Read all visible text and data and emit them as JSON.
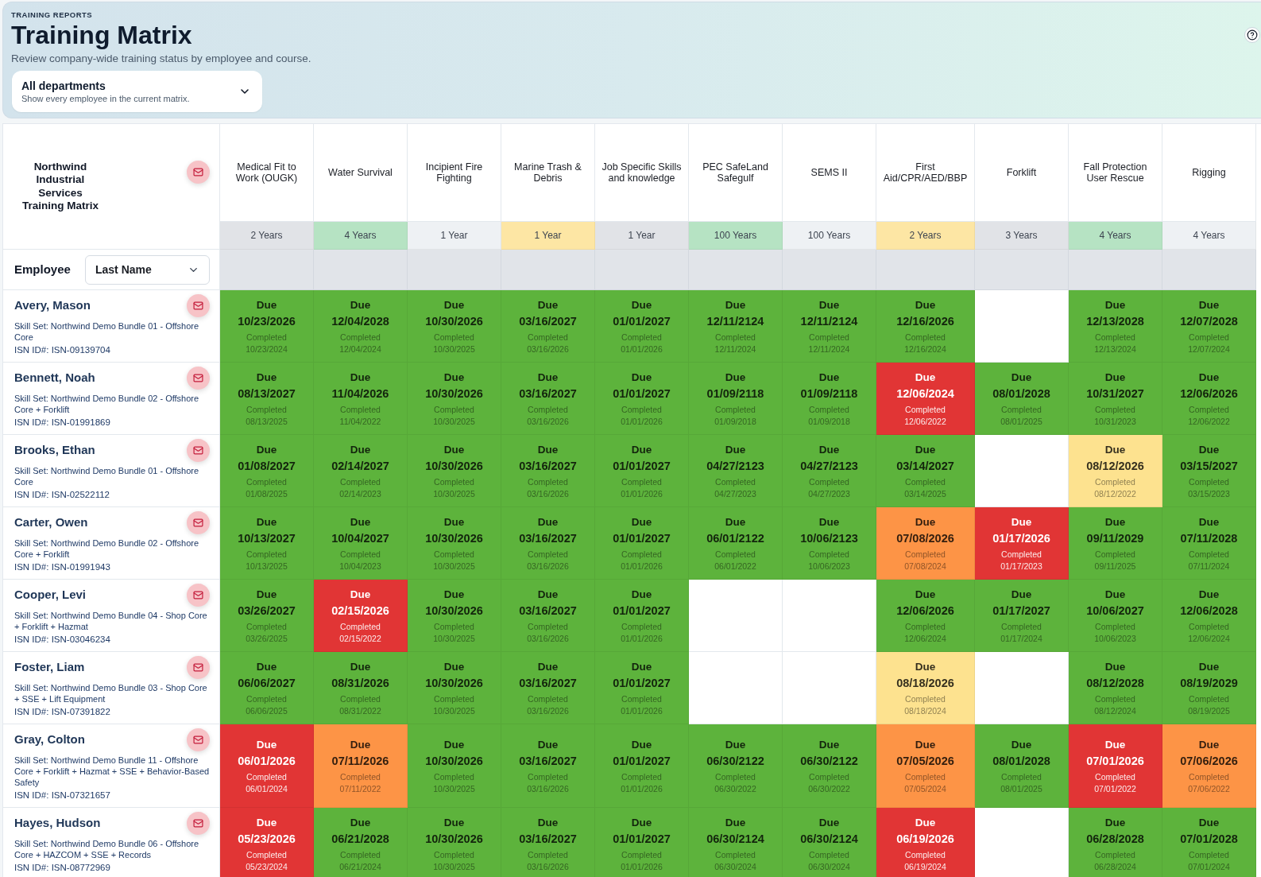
{
  "header": {
    "eyebrow": "TRAINING REPORTS",
    "title": "Training Matrix",
    "description": "Review company-wide training status by employee and course.",
    "department_select": {
      "value": "All departments",
      "hint": "Show every employee in the current matrix."
    }
  },
  "matrix": {
    "title": "Northwind Industrial Services Training Matrix",
    "employee_label": "Employee",
    "sort_select": {
      "value": "Last Name"
    },
    "courses": [
      {
        "name": "Medical Fit to Work (OUGK)",
        "period": "2 Years",
        "color": "#e1e3e7"
      },
      {
        "name": "Water Survival",
        "period": "4 Years",
        "color": "#b6e3c3"
      },
      {
        "name": "Incipient Fire Fighting",
        "period": "1 Year",
        "color": "#eef1f4"
      },
      {
        "name": "Marine Trash & Debris",
        "period": "1 Year",
        "color": "#fde6a4"
      },
      {
        "name": "Job Specific Skills and knowledge",
        "period": "1 Year",
        "color": "#e1e3e7"
      },
      {
        "name": "PEC SafeLand Safegulf",
        "period": "100 Years",
        "color": "#b6e3c3"
      },
      {
        "name": "SEMS II",
        "period": "100 Years",
        "color": "#eef1f4"
      },
      {
        "name": "First Aid/CPR/AED/BBP",
        "period": "2 Years",
        "color": "#fde6a4"
      },
      {
        "name": "Forklift",
        "period": "3 Years",
        "color": "#e1e3e7"
      },
      {
        "name": "Fall Protection User Rescue",
        "period": "4 Years",
        "color": "#b6e3c3"
      },
      {
        "name": "Rigging",
        "period": "4 Years",
        "color": "#eef1f4"
      }
    ],
    "rows": [
      {
        "name": "Avery, Mason",
        "skill_set": "Skill Set: Northwind Demo Bundle 01 - Offshore Core",
        "isn_id": "ISN ID#: ISN-09139704",
        "cells": [
          {
            "kind": "record",
            "color": "#5db33c",
            "due_label": "Due",
            "due": "10/23/2026",
            "completed_label": "Completed",
            "completed": "10/23/2024"
          },
          {
            "kind": "record",
            "color": "#5db33c",
            "due_label": "Due",
            "due": "12/04/2028",
            "completed_label": "Completed",
            "completed": "12/04/2024"
          },
          {
            "kind": "record",
            "color": "#5db33c",
            "due_label": "Due",
            "due": "10/30/2026",
            "completed_label": "Completed",
            "completed": "10/30/2025"
          },
          {
            "kind": "record",
            "color": "#5db33c",
            "due_label": "Due",
            "due": "03/16/2027",
            "completed_label": "Completed",
            "completed": "03/16/2026"
          },
          {
            "kind": "record",
            "color": "#5db33c",
            "due_label": "Due",
            "due": "01/01/2027",
            "completed_label": "Completed",
            "completed": "01/01/2026"
          },
          {
            "kind": "record",
            "color": "#5db33c",
            "due_label": "Due",
            "due": "12/11/2124",
            "completed_label": "Completed",
            "completed": "12/11/2024"
          },
          {
            "kind": "record",
            "color": "#5db33c",
            "due_label": "Due",
            "due": "12/11/2124",
            "completed_label": "Completed",
            "completed": "12/11/2024"
          },
          {
            "kind": "record",
            "color": "#5db33c",
            "due_label": "Due",
            "due": "12/16/2026",
            "completed_label": "Completed",
            "completed": "12/16/2024"
          },
          {
            "kind": "blank"
          },
          {
            "kind": "record",
            "color": "#5db33c",
            "due_label": "Due",
            "due": "12/13/2028",
            "completed_label": "Completed",
            "completed": "12/13/2024"
          },
          {
            "kind": "record",
            "color": "#5db33c",
            "due_label": "Due",
            "due": "12/07/2028",
            "completed_label": "Completed",
            "completed": "12/07/2024"
          }
        ]
      },
      {
        "name": "Bennett, Noah",
        "skill_set": "Skill Set: Northwind Demo Bundle 02 - Offshore Core + Forklift",
        "isn_id": "ISN ID#: ISN-01991869",
        "cells": [
          {
            "kind": "record",
            "color": "#5db33c",
            "due_label": "Due",
            "due": "08/13/2027",
            "completed_label": "Completed",
            "completed": "08/13/2025"
          },
          {
            "kind": "record",
            "color": "#5db33c",
            "due_label": "Due",
            "due": "11/04/2026",
            "completed_label": "Completed",
            "completed": "11/04/2022"
          },
          {
            "kind": "record",
            "color": "#5db33c",
            "due_label": "Due",
            "due": "10/30/2026",
            "completed_label": "Completed",
            "completed": "10/30/2025"
          },
          {
            "kind": "record",
            "color": "#5db33c",
            "due_label": "Due",
            "due": "03/16/2027",
            "completed_label": "Completed",
            "completed": "03/16/2026"
          },
          {
            "kind": "record",
            "color": "#5db33c",
            "due_label": "Due",
            "due": "01/01/2027",
            "completed_label": "Completed",
            "completed": "01/01/2026"
          },
          {
            "kind": "record",
            "color": "#5db33c",
            "due_label": "Due",
            "due": "01/09/2118",
            "completed_label": "Completed",
            "completed": "01/09/2018"
          },
          {
            "kind": "record",
            "color": "#5db33c",
            "due_label": "Due",
            "due": "01/09/2118",
            "completed_label": "Completed",
            "completed": "01/09/2018"
          },
          {
            "kind": "record",
            "color": "#e13535",
            "due_label": "Due",
            "due": "12/06/2024",
            "completed_label": "Completed",
            "completed": "12/06/2022"
          },
          {
            "kind": "record",
            "color": "#5db33c",
            "due_label": "Due",
            "due": "08/01/2028",
            "completed_label": "Completed",
            "completed": "08/01/2025"
          },
          {
            "kind": "record",
            "color": "#5db33c",
            "due_label": "Due",
            "due": "10/31/2027",
            "completed_label": "Completed",
            "completed": "10/31/2023"
          },
          {
            "kind": "record",
            "color": "#5db33c",
            "due_label": "Due",
            "due": "12/06/2026",
            "completed_label": "Completed",
            "completed": "12/06/2022"
          }
        ]
      },
      {
        "name": "Brooks, Ethan",
        "skill_set": "Skill Set: Northwind Demo Bundle 01 - Offshore Core",
        "isn_id": "ISN ID#: ISN-02522112",
        "cells": [
          {
            "kind": "record",
            "color": "#5db33c",
            "due_label": "Due",
            "due": "01/08/2027",
            "completed_label": "Completed",
            "completed": "01/08/2025"
          },
          {
            "kind": "record",
            "color": "#5db33c",
            "due_label": "Due",
            "due": "02/14/2027",
            "completed_label": "Completed",
            "completed": "02/14/2023"
          },
          {
            "kind": "record",
            "color": "#5db33c",
            "due_label": "Due",
            "due": "10/30/2026",
            "completed_label": "Completed",
            "completed": "10/30/2025"
          },
          {
            "kind": "record",
            "color": "#5db33c",
            "due_label": "Due",
            "due": "03/16/2027",
            "completed_label": "Completed",
            "completed": "03/16/2026"
          },
          {
            "kind": "record",
            "color": "#5db33c",
            "due_label": "Due",
            "due": "01/01/2027",
            "completed_label": "Completed",
            "completed": "01/01/2026"
          },
          {
            "kind": "record",
            "color": "#5db33c",
            "due_label": "Due",
            "due": "04/27/2123",
            "completed_label": "Completed",
            "completed": "04/27/2023"
          },
          {
            "kind": "record",
            "color": "#5db33c",
            "due_label": "Due",
            "due": "04/27/2123",
            "completed_label": "Completed",
            "completed": "04/27/2023"
          },
          {
            "kind": "record",
            "color": "#5db33c",
            "due_label": "Due",
            "due": "03/14/2027",
            "completed_label": "Completed",
            "completed": "03/14/2025"
          },
          {
            "kind": "blank"
          },
          {
            "kind": "record",
            "color": "#fde28f",
            "due_label": "Due",
            "due": "08/12/2026",
            "completed_label": "Completed",
            "completed": "08/12/2022"
          },
          {
            "kind": "record",
            "color": "#5db33c",
            "due_label": "Due",
            "due": "03/15/2027",
            "completed_label": "Completed",
            "completed": "03/15/2023"
          }
        ]
      },
      {
        "name": "Carter, Owen",
        "skill_set": "Skill Set: Northwind Demo Bundle 02 - Offshore Core + Forklift",
        "isn_id": "ISN ID#: ISN-01991943",
        "cells": [
          {
            "kind": "record",
            "color": "#5db33c",
            "due_label": "Due",
            "due": "10/13/2027",
            "completed_label": "Completed",
            "completed": "10/13/2025"
          },
          {
            "kind": "record",
            "color": "#5db33c",
            "due_label": "Due",
            "due": "10/04/2027",
            "completed_label": "Completed",
            "completed": "10/04/2023"
          },
          {
            "kind": "record",
            "color": "#5db33c",
            "due_label": "Due",
            "due": "10/30/2026",
            "completed_label": "Completed",
            "completed": "10/30/2025"
          },
          {
            "kind": "record",
            "color": "#5db33c",
            "due_label": "Due",
            "due": "03/16/2027",
            "completed_label": "Completed",
            "completed": "03/16/2026"
          },
          {
            "kind": "record",
            "color": "#5db33c",
            "due_label": "Due",
            "due": "01/01/2027",
            "completed_label": "Completed",
            "completed": "01/01/2026"
          },
          {
            "kind": "record",
            "color": "#5db33c",
            "due_label": "Due",
            "due": "06/01/2122",
            "completed_label": "Completed",
            "completed": "06/01/2022"
          },
          {
            "kind": "record",
            "color": "#5db33c",
            "due_label": "Due",
            "due": "10/06/2123",
            "completed_label": "Completed",
            "completed": "10/06/2023"
          },
          {
            "kind": "record",
            "color": "#fd9446",
            "due_label": "Due",
            "due": "07/08/2026",
            "completed_label": "Completed",
            "completed": "07/08/2024"
          },
          {
            "kind": "record",
            "color": "#e13535",
            "due_label": "Due",
            "due": "01/17/2026",
            "completed_label": "Completed",
            "completed": "01/17/2023"
          },
          {
            "kind": "record",
            "color": "#5db33c",
            "due_label": "Due",
            "due": "09/11/2029",
            "completed_label": "Completed",
            "completed": "09/11/2025"
          },
          {
            "kind": "record",
            "color": "#5db33c",
            "due_label": "Due",
            "due": "07/11/2028",
            "completed_label": "Completed",
            "completed": "07/11/2024"
          }
        ]
      },
      {
        "name": "Cooper, Levi",
        "skill_set": "Skill Set: Northwind Demo Bundle 04 - Shop Core + Forklift + Hazmat",
        "isn_id": "ISN ID#: ISN-03046234",
        "cells": [
          {
            "kind": "record",
            "color": "#5db33c",
            "due_label": "Due",
            "due": "03/26/2027",
            "completed_label": "Completed",
            "completed": "03/26/2025"
          },
          {
            "kind": "record",
            "color": "#e13535",
            "due_label": "Due",
            "due": "02/15/2026",
            "completed_label": "Completed",
            "completed": "02/15/2022"
          },
          {
            "kind": "record",
            "color": "#5db33c",
            "due_label": "Due",
            "due": "10/30/2026",
            "completed_label": "Completed",
            "completed": "10/30/2025"
          },
          {
            "kind": "record",
            "color": "#5db33c",
            "due_label": "Due",
            "due": "03/16/2027",
            "completed_label": "Completed",
            "completed": "03/16/2026"
          },
          {
            "kind": "record",
            "color": "#5db33c",
            "due_label": "Due",
            "due": "01/01/2027",
            "completed_label": "Completed",
            "completed": "01/01/2026"
          },
          {
            "kind": "blank"
          },
          {
            "kind": "blank"
          },
          {
            "kind": "record",
            "color": "#5db33c",
            "due_label": "Due",
            "due": "12/06/2026",
            "completed_label": "Completed",
            "completed": "12/06/2024"
          },
          {
            "kind": "record",
            "color": "#5db33c",
            "due_label": "Due",
            "due": "01/17/2027",
            "completed_label": "Completed",
            "completed": "01/17/2024"
          },
          {
            "kind": "record",
            "color": "#5db33c",
            "due_label": "Due",
            "due": "10/06/2027",
            "completed_label": "Completed",
            "completed": "10/06/2023"
          },
          {
            "kind": "record",
            "color": "#5db33c",
            "due_label": "Due",
            "due": "12/06/2028",
            "completed_label": "Completed",
            "completed": "12/06/2024"
          }
        ]
      },
      {
        "name": "Foster, Liam",
        "skill_set": "Skill Set: Northwind Demo Bundle 03 - Shop Core + SSE + Lift Equipment",
        "isn_id": "ISN ID#: ISN-07391822",
        "cells": [
          {
            "kind": "record",
            "color": "#5db33c",
            "due_label": "Due",
            "due": "06/06/2027",
            "completed_label": "Completed",
            "completed": "06/06/2025"
          },
          {
            "kind": "record",
            "color": "#5db33c",
            "due_label": "Due",
            "due": "08/31/2026",
            "completed_label": "Completed",
            "completed": "08/31/2022"
          },
          {
            "kind": "record",
            "color": "#5db33c",
            "due_label": "Due",
            "due": "10/30/2026",
            "completed_label": "Completed",
            "completed": "10/30/2025"
          },
          {
            "kind": "record",
            "color": "#5db33c",
            "due_label": "Due",
            "due": "03/16/2027",
            "completed_label": "Completed",
            "completed": "03/16/2026"
          },
          {
            "kind": "record",
            "color": "#5db33c",
            "due_label": "Due",
            "due": "01/01/2027",
            "completed_label": "Completed",
            "completed": "01/01/2026"
          },
          {
            "kind": "blank"
          },
          {
            "kind": "blank"
          },
          {
            "kind": "record",
            "color": "#fde28f",
            "due_label": "Due",
            "due": "08/18/2026",
            "completed_label": "Completed",
            "completed": "08/18/2024"
          },
          {
            "kind": "blank"
          },
          {
            "kind": "record",
            "color": "#5db33c",
            "due_label": "Due",
            "due": "08/12/2028",
            "completed_label": "Completed",
            "completed": "08/12/2024"
          },
          {
            "kind": "record",
            "color": "#5db33c",
            "due_label": "Due",
            "due": "08/19/2029",
            "completed_label": "Completed",
            "completed": "08/19/2025"
          }
        ]
      },
      {
        "name": "Gray, Colton",
        "skill_set": "Skill Set: Northwind Demo Bundle 11 - Offshore Core + Forklift + Hazmat + SSE + Behavior-Based Safety",
        "isn_id": "ISN ID#: ISN-07321657",
        "cells": [
          {
            "kind": "record",
            "color": "#e13535",
            "due_label": "Due",
            "due": "06/01/2026",
            "completed_label": "Completed",
            "completed": "06/01/2024"
          },
          {
            "kind": "record",
            "color": "#fd9446",
            "due_label": "Due",
            "due": "07/11/2026",
            "completed_label": "Completed",
            "completed": "07/11/2022"
          },
          {
            "kind": "record",
            "color": "#5db33c",
            "due_label": "Due",
            "due": "10/30/2026",
            "completed_label": "Completed",
            "completed": "10/30/2025"
          },
          {
            "kind": "record",
            "color": "#5db33c",
            "due_label": "Due",
            "due": "03/16/2027",
            "completed_label": "Completed",
            "completed": "03/16/2026"
          },
          {
            "kind": "record",
            "color": "#5db33c",
            "due_label": "Due",
            "due": "01/01/2027",
            "completed_label": "Completed",
            "completed": "01/01/2026"
          },
          {
            "kind": "record",
            "color": "#5db33c",
            "due_label": "Due",
            "due": "06/30/2122",
            "completed_label": "Completed",
            "completed": "06/30/2022"
          },
          {
            "kind": "record",
            "color": "#5db33c",
            "due_label": "Due",
            "due": "06/30/2122",
            "completed_label": "Completed",
            "completed": "06/30/2022"
          },
          {
            "kind": "record",
            "color": "#fd9446",
            "due_label": "Due",
            "due": "07/05/2026",
            "completed_label": "Completed",
            "completed": "07/05/2024"
          },
          {
            "kind": "record",
            "color": "#5db33c",
            "due_label": "Due",
            "due": "08/01/2028",
            "completed_label": "Completed",
            "completed": "08/01/2025"
          },
          {
            "kind": "record",
            "color": "#e13535",
            "due_label": "Due",
            "due": "07/01/2026",
            "completed_label": "Completed",
            "completed": "07/01/2022"
          },
          {
            "kind": "record",
            "color": "#fd9446",
            "due_label": "Due",
            "due": "07/06/2026",
            "completed_label": "Completed",
            "completed": "07/06/2022"
          }
        ]
      },
      {
        "name": "Hayes, Hudson",
        "skill_set": "Skill Set: Northwind Demo Bundle 06 - Offshore Core + HAZCOM + SSE + Records",
        "isn_id": "ISN ID#: ISN-08772969",
        "cells": [
          {
            "kind": "record",
            "color": "#e13535",
            "due_label": "Due",
            "due": "05/23/2026",
            "completed_label": "Completed",
            "completed": "05/23/2024"
          },
          {
            "kind": "record",
            "color": "#5db33c",
            "due_label": "Due",
            "due": "06/21/2028",
            "completed_label": "Completed",
            "completed": "06/21/2024"
          },
          {
            "kind": "record",
            "color": "#5db33c",
            "due_label": "Due",
            "due": "10/30/2026",
            "completed_label": "Completed",
            "completed": "10/30/2025"
          },
          {
            "kind": "record",
            "color": "#5db33c",
            "due_label": "Due",
            "due": "03/16/2027",
            "completed_label": "Completed",
            "completed": "03/16/2026"
          },
          {
            "kind": "record",
            "color": "#5db33c",
            "due_label": "Due",
            "due": "01/01/2027",
            "completed_label": "Completed",
            "completed": "01/01/2026"
          },
          {
            "kind": "record",
            "color": "#5db33c",
            "due_label": "Due",
            "due": "06/30/2124",
            "completed_label": "Completed",
            "completed": "06/30/2024"
          },
          {
            "kind": "record",
            "color": "#5db33c",
            "due_label": "Due",
            "due": "06/30/2124",
            "completed_label": "Completed",
            "completed": "06/30/2024"
          },
          {
            "kind": "record",
            "color": "#e13535",
            "due_label": "Due",
            "due": "06/19/2026",
            "completed_label": "Completed",
            "completed": "06/19/2024"
          },
          {
            "kind": "blank"
          },
          {
            "kind": "record",
            "color": "#5db33c",
            "due_label": "Due",
            "due": "06/28/2028",
            "completed_label": "Completed",
            "completed": "06/28/2024"
          },
          {
            "kind": "record",
            "color": "#5db33c",
            "due_label": "Due",
            "due": "07/01/2028",
            "completed_label": "Completed",
            "completed": "07/01/2024"
          }
        ]
      }
    ]
  }
}
